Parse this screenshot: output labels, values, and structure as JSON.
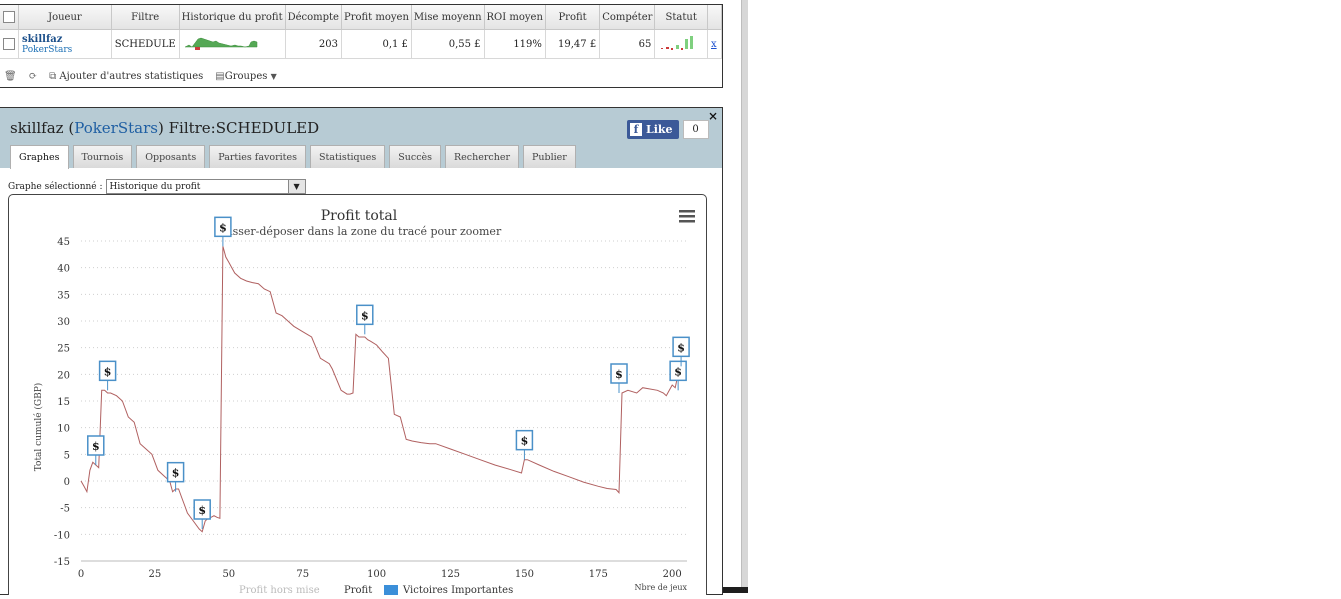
{
  "table": {
    "headers": [
      "Joueur",
      "Filtre",
      "Historique du profit",
      "Décompte",
      "Profit moyen",
      "Mise moyenn",
      "ROI moyen",
      "Profit",
      "Compéter",
      "Statut"
    ],
    "row": {
      "player": "skillfaz",
      "site": "PokerStars",
      "filter": "SCHEDULE",
      "count": "203",
      "avg_profit": "0,1 £",
      "avg_stake": "0,55 £",
      "avg_roi": "119%",
      "profit": "19,47 £",
      "competence": "65",
      "remove": "x"
    }
  },
  "toolbar": {
    "add_stats": "Ajouter d'autres statistiques",
    "groups": "Groupes"
  },
  "panel": {
    "player": "skillfaz",
    "site": "PokerStars",
    "filter_label": "Filtre:",
    "filter_value": "SCHEDULED",
    "like_label": "Like",
    "like_count": "0",
    "close": "×"
  },
  "tabs": [
    "Graphes",
    "Tournois",
    "Opposants",
    "Parties favorites",
    "Statistiques",
    "Succès",
    "Rechercher",
    "Publier"
  ],
  "graph_select": {
    "label": "Graphe sélectionné :",
    "value": "Historique du profit"
  },
  "chart_data": {
    "type": "line",
    "title": "Profit total",
    "subtitle": "Glisser-déposer dans la zone du tracé pour zoomer",
    "ylabel": "Total cumulé (GBP)",
    "xlabel": "Nbre de jeux",
    "xlim": [
      0,
      205
    ],
    "ylim": [
      -15,
      45
    ],
    "xticks": [
      0,
      25,
      50,
      75,
      100,
      125,
      150,
      175,
      200
    ],
    "yticks": [
      -15,
      -10,
      -5,
      0,
      5,
      10,
      15,
      20,
      25,
      30,
      35,
      40,
      45
    ],
    "grid": true,
    "legend": [
      "Profit hors mise",
      "Profit",
      "Victoires Importantes"
    ],
    "series": [
      {
        "name": "Profit",
        "color": "#b06060",
        "x": [
          0,
          1,
          2,
          3,
          4,
          5,
          6,
          7,
          8,
          9,
          10,
          12,
          14,
          16,
          18,
          20,
          22,
          24,
          26,
          28,
          30,
          31,
          32,
          33,
          34,
          35,
          36,
          38,
          40,
          41,
          42,
          43,
          44,
          45,
          46,
          47,
          48,
          49,
          50,
          52,
          54,
          56,
          58,
          60,
          62,
          64,
          66,
          68,
          70,
          72,
          75,
          78,
          81,
          84,
          85,
          88,
          90,
          91,
          92,
          93,
          94,
          95,
          96,
          97,
          98,
          100,
          102,
          104,
          106,
          108,
          110,
          112,
          115,
          118,
          120,
          125,
          130,
          135,
          140,
          145,
          149,
          150,
          151,
          155,
          160,
          165,
          170,
          175,
          178,
          181,
          182,
          183,
          185,
          188,
          190,
          195,
          197,
          198,
          199,
          200,
          201,
          202,
          203
        ],
        "y": [
          0,
          -1,
          -2,
          2,
          3.5,
          3,
          2.5,
          17,
          17,
          16.5,
          16.5,
          16,
          15,
          12,
          11,
          7,
          6,
          5,
          2,
          1,
          0,
          -2,
          -1.5,
          -1.5,
          -3,
          -4.5,
          -6,
          -7.5,
          -9,
          -9.5,
          -7.5,
          -7,
          -6.8,
          -6.5,
          -6.8,
          -7,
          44,
          42,
          41,
          39,
          38,
          37.5,
          37.2,
          37,
          36,
          35.5,
          31.5,
          31,
          30,
          29,
          28,
          27,
          23,
          22,
          21,
          17,
          16.3,
          16.3,
          16.5,
          27.5,
          27,
          27,
          27,
          26.5,
          26.2,
          25.5,
          24.2,
          23,
          12.5,
          12,
          7.8,
          7.5,
          7.2,
          7,
          7,
          6,
          5,
          4,
          3,
          2.2,
          1.5,
          4,
          4,
          3,
          1.8,
          0.8,
          -0.2,
          -1,
          -1.4,
          -1.6,
          -2.2,
          16.5,
          17,
          16.5,
          17.5,
          17,
          16.5,
          16,
          17,
          18,
          17.5,
          20,
          21.5
        ]
      }
    ],
    "markers": [
      {
        "x": 5,
        "y": 3,
        "label": "$"
      },
      {
        "x": 9,
        "y": 17,
        "label": "$"
      },
      {
        "x": 32,
        "y": -2,
        "label": "$"
      },
      {
        "x": 41,
        "y": -9,
        "label": "$"
      },
      {
        "x": 48,
        "y": 44,
        "label": "$"
      },
      {
        "x": 96,
        "y": 27.5,
        "label": "$"
      },
      {
        "x": 150,
        "y": 4,
        "label": "$"
      },
      {
        "x": 182,
        "y": 16.5,
        "label": "$"
      },
      {
        "x": 202,
        "y": 17,
        "label": "$"
      },
      {
        "x": 203,
        "y": 21.5,
        "label": "$"
      }
    ]
  }
}
